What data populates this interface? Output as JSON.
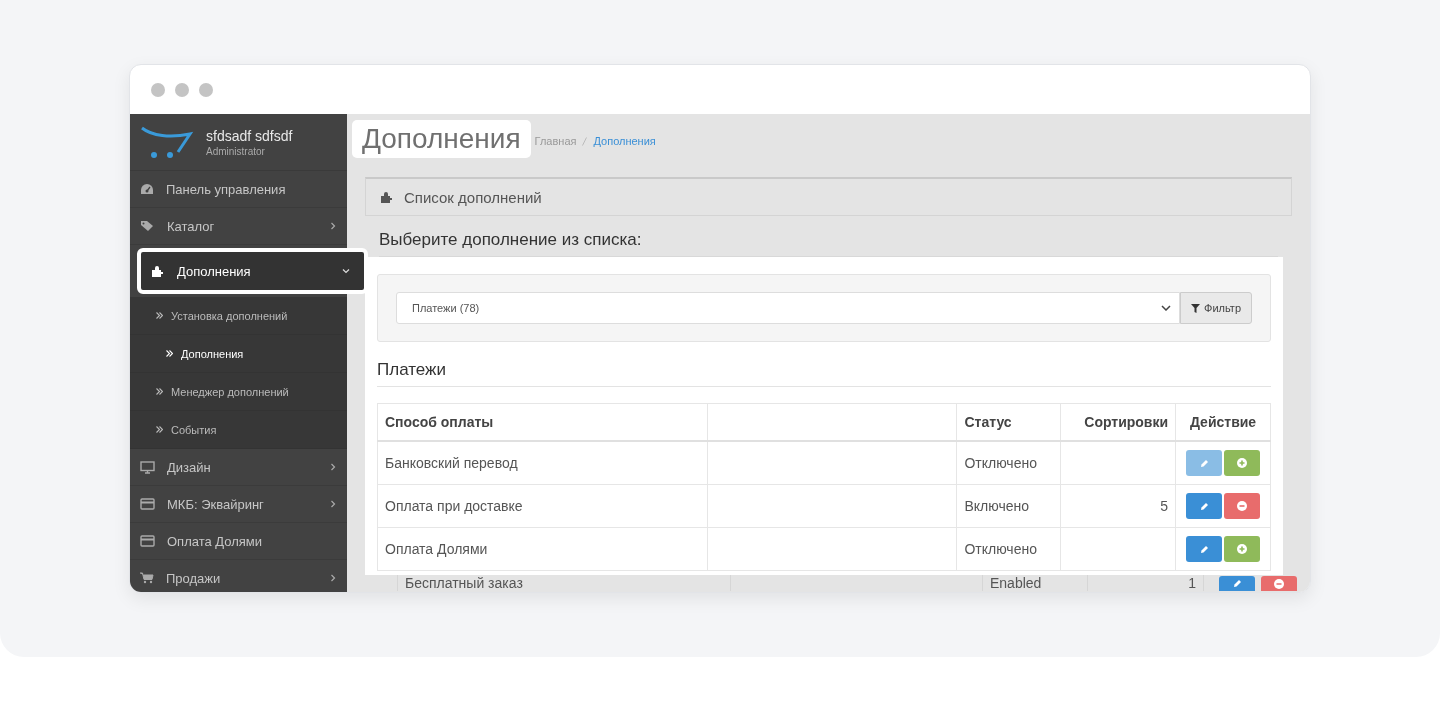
{
  "user": {
    "name": "sfdsadf sdfsdf",
    "role": "Administrator"
  },
  "sidebar": {
    "items": [
      {
        "label": "Панель управления",
        "kind": "dashboard",
        "highlighted": false
      },
      {
        "label": "Каталог",
        "kind": "tags",
        "expanded": false,
        "highlighted": false
      },
      {
        "label": "Дополнения",
        "kind": "puzzle",
        "expanded": true,
        "highlighted": true,
        "children": [
          {
            "label": "Установка дополнений",
            "selected": false
          },
          {
            "label": "Дополнения",
            "selected": true
          },
          {
            "label": "Менеджер дополнений",
            "selected": false
          },
          {
            "label": "События",
            "selected": false
          }
        ]
      },
      {
        "label": "Дизайн",
        "kind": "desktop",
        "expanded": false,
        "highlighted": false
      },
      {
        "label": "МКБ: Эквайринг",
        "kind": "card",
        "expanded": false,
        "highlighted": false
      },
      {
        "label": "Оплата Долями",
        "kind": "card",
        "highlighted": false
      },
      {
        "label": "Продажи",
        "kind": "cart",
        "expanded": false,
        "highlighted": false
      }
    ]
  },
  "page_title": {
    "text": "Дополнения",
    "highlighted": true
  },
  "breadcrumb": [
    {
      "label": "Главная",
      "current": false
    },
    {
      "label": "Дополнения",
      "current": true
    }
  ],
  "panel": {
    "title": "Список дополнений",
    "prompt": "Выберите дополнение из списка:",
    "highlighted": true,
    "filter": {
      "value": "Платежи (78)",
      "button": "Фильтр"
    },
    "section_title": "Платежи",
    "table": {
      "columns": [
        "Способ оплаты",
        "",
        "Статус",
        "Сортировки",
        "Действие"
      ],
      "rows": [
        {
          "name": "Банковский перевод",
          "status": "Отключено",
          "sort": "",
          "edit_enabled": false,
          "installed": false,
          "highlighted": true
        },
        {
          "name": "Оплата при доставке",
          "status": "Включено",
          "sort": "5",
          "edit_enabled": true,
          "installed": true,
          "highlighted": true
        },
        {
          "name": "Оплата Долями",
          "status": "Отключено",
          "sort": "",
          "edit_enabled": true,
          "installed": false,
          "highlighted": true
        },
        {
          "name": "Бесплатный заказ",
          "status": "Enabled",
          "sort": "1",
          "edit_enabled": true,
          "installed": true,
          "highlighted": false
        }
      ]
    }
  }
}
